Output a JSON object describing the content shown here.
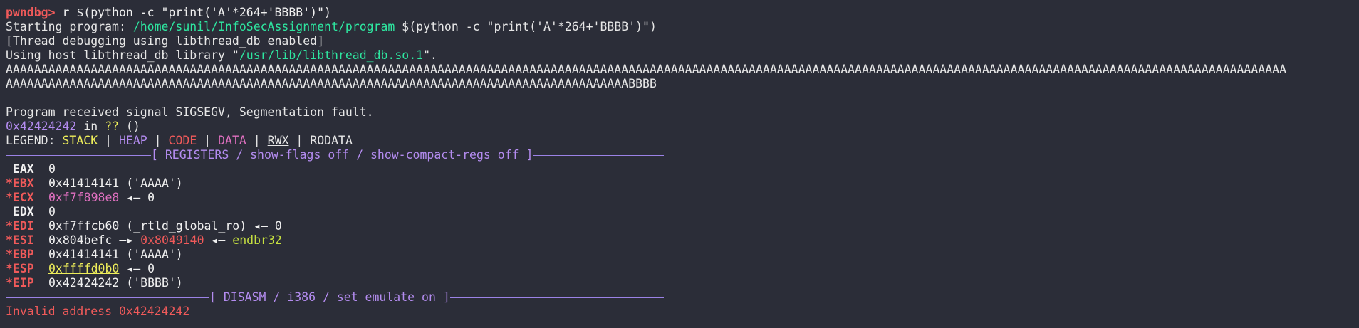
{
  "colors": {
    "background": "#2b2d38",
    "prompt": "#f05a5a",
    "path": "#2ee6a0",
    "address": "#b48cf0",
    "stack": "#eded5a",
    "heap": "#b48cf0",
    "code": "#f05a5a",
    "data": "#e070c0",
    "separator": "#9b82e6",
    "error": "#f05a5a"
  },
  "cut_line": "--------------------------------",
  "command": {
    "prompt": "pwndbg>",
    "text": " r $(python -c \"print('A'*264+'BBBB')\")"
  },
  "starting": {
    "prefix": "Starting program: ",
    "path": "/home/sunil/InfoSecAssignment/program",
    "args": " $(python -c \"print('A'*264+'BBBB')\")"
  },
  "thread_debug": "[Thread debugging using libthread_db enabled]",
  "libthread": {
    "prefix": "Using host libthread_db library \"",
    "path": "/usr/lib/libthread_db.so.1",
    "suffix": "\"."
  },
  "payload_line1": "AAAAAAAAAAAAAAAAAAAAAAAAAAAAAAAAAAAAAAAAAAAAAAAAAAAAAAAAAAAAAAAAAAAAAAAAAAAAAAAAAAAAAAAAAAAAAAAAAAAAAAAAAAAAAAAAAAAAAAAAAAAAAAAAAAAAAAAAAAAAAAAAAAAAAAAAAAAAAAAAAAAAAAAAAAAAAAAAAAAAA",
  "payload_line2": "AAAAAAAAAAAAAAAAAAAAAAAAAAAAAAAAAAAAAAAAAAAAAAAAAAAAAAAAAAAAAAAAAAAAAAAAAAAAAAAAAAAAAAAABBBB",
  "signal": "Program received signal SIGSEGV, Segmentation fault.",
  "location": {
    "address": "0x42424242",
    "in": " in ",
    "func": "??",
    "tail": " ()"
  },
  "legend": {
    "label": "LEGEND: ",
    "sep": " | ",
    "stack": "STACK",
    "heap": "HEAP",
    "code": "CODE",
    "data": "DATA",
    "rwx": "RWX",
    "rodata": "RODATA"
  },
  "registers_header": "[ REGISTERS / show-flags off / show-compact-regs off ]",
  "registers": [
    {
      "mark": " ",
      "name": "EAX",
      "parts": [
        {
          "t": "0",
          "c": "white"
        }
      ]
    },
    {
      "mark": "*",
      "name": "EBX",
      "parts": [
        {
          "t": "0x41414141 ('AAAA')",
          "c": "white"
        }
      ]
    },
    {
      "mark": "*",
      "name": "ECX",
      "parts": [
        {
          "t": "0xf7f898e8",
          "c": "pink"
        },
        {
          "t": " ◂— 0",
          "c": "white"
        }
      ]
    },
    {
      "mark": " ",
      "name": "EDX",
      "parts": [
        {
          "t": "0",
          "c": "white"
        }
      ]
    },
    {
      "mark": "*",
      "name": "EDI",
      "parts": [
        {
          "t": "0xf7ffcb60 (_rtld_global_ro) ◂— 0",
          "c": "white"
        }
      ]
    },
    {
      "mark": "*",
      "name": "ESI",
      "parts": [
        {
          "t": "0x804befc —▸ ",
          "c": "white"
        },
        {
          "t": "0x8049140",
          "c": "red"
        },
        {
          "t": " ◂— ",
          "c": "white"
        },
        {
          "t": "endbr32",
          "c": "olive"
        }
      ]
    },
    {
      "mark": "*",
      "name": "EBP",
      "parts": [
        {
          "t": "0x41414141 ('AAAA')",
          "c": "white"
        }
      ]
    },
    {
      "mark": "*",
      "name": "ESP",
      "parts": [
        {
          "t": "0xffffd0b0",
          "c": "yellow ul"
        },
        {
          "t": " ◂— 0",
          "c": "white"
        }
      ]
    },
    {
      "mark": "*",
      "name": "EIP",
      "parts": [
        {
          "t": "0x42424242 ('BBBB')",
          "c": "white"
        }
      ]
    }
  ],
  "disasm_header": "[ DISASM / i386 / set emulate on ]",
  "invalid": "Invalid address 0x42424242"
}
